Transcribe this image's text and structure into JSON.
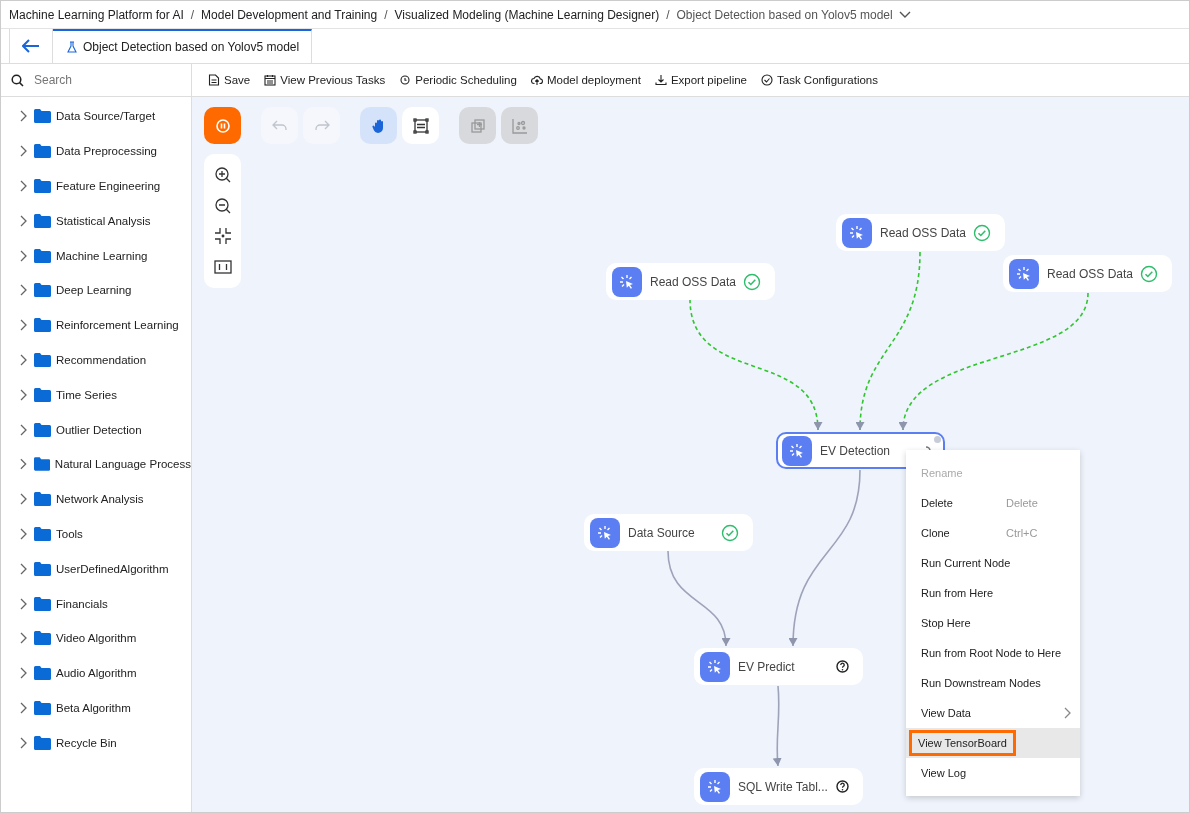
{
  "breadcrumbs": [
    {
      "label": "Machine Learning Platform for AI",
      "current": false,
      "separator": "/"
    },
    {
      "label": "Model Development and Training",
      "current": false,
      "separator": "/"
    },
    {
      "label": "Visualized Modeling (Machine Learning Designer)",
      "current": false,
      "separator": "/"
    },
    {
      "label": "Object Detection based on Yolov5 model",
      "current": true
    }
  ],
  "tabs": [
    {
      "label": "Object Detection based on Yolov5 model",
      "selected": true
    }
  ],
  "search": {
    "placeholder": "Search"
  },
  "toolbar": [
    {
      "kind": "save",
      "label": "Save"
    },
    {
      "kind": "calendar",
      "label": "View Previous Tasks"
    },
    {
      "kind": "clock",
      "label": "Periodic Scheduling"
    },
    {
      "kind": "cloud",
      "label": "Model deployment"
    },
    {
      "kind": "export",
      "label": "Export pipeline"
    },
    {
      "kind": "check",
      "label": "Task Configurations"
    }
  ],
  "sidebar": {
    "items": [
      {
        "label": "Data Source/Target",
        "expanded": false
      },
      {
        "label": "Data Preprocessing",
        "expanded": false
      },
      {
        "label": "Feature Engineering",
        "expanded": false
      },
      {
        "label": "Statistical Analysis",
        "expanded": false
      },
      {
        "label": "Machine Learning",
        "expanded": false
      },
      {
        "label": "Deep Learning",
        "expanded": false
      },
      {
        "label": "Reinforcement Learning",
        "expanded": false
      },
      {
        "label": "Recommendation",
        "expanded": false
      },
      {
        "label": "Time Series",
        "expanded": false
      },
      {
        "label": "Outlier Detection",
        "expanded": false
      },
      {
        "label": "Natural Language Process",
        "expanded": false
      },
      {
        "label": "Network Analysis",
        "expanded": false
      },
      {
        "label": "Tools",
        "expanded": false
      },
      {
        "label": "UserDefinedAlgorithm",
        "expanded": false
      },
      {
        "label": "Financials",
        "expanded": false
      },
      {
        "label": "Video Algorithm",
        "expanded": false
      },
      {
        "label": "Audio Algorithm",
        "expanded": false
      },
      {
        "label": "Beta Algorithm",
        "expanded": false
      },
      {
        "label": "Recycle Bin",
        "expanded": false
      }
    ]
  },
  "canvas_tools": [
    {
      "kind": "pause",
      "disabled": false,
      "selected": false
    },
    {
      "kind": "undo",
      "disabled": true,
      "selected": false
    },
    {
      "kind": "redo",
      "disabled": true,
      "selected": false
    },
    {
      "kind": "hand",
      "disabled": false,
      "selected": true
    },
    {
      "kind": "frame",
      "disabled": false,
      "selected": false
    },
    {
      "kind": "group",
      "disabled": true,
      "selected": false
    },
    {
      "kind": "scatter",
      "disabled": true,
      "selected": false
    }
  ],
  "nodes": [
    {
      "label": "Read OSS Data",
      "kind": "success",
      "selected": false
    },
    {
      "label": "Read OSS Data",
      "kind": "success",
      "selected": false
    },
    {
      "label": "Read OSS Data",
      "kind": "success",
      "selected": false
    },
    {
      "label": "EV Detection",
      "kind": "running",
      "selected": true,
      "inputs": [
        {
          "dashed": true
        },
        {
          "dashed": true
        },
        {
          "dashed": true
        }
      ]
    },
    {
      "label": "Data Source",
      "kind": "success",
      "selected": false
    },
    {
      "label": "EV Predict",
      "kind": "unknown",
      "selected": false,
      "inputs": [
        {
          "dashed": false
        },
        {
          "dashed": false
        }
      ]
    },
    {
      "label": "SQL Write Tabl...",
      "kind": "unknown",
      "selected": false,
      "inputs": [
        {
          "dashed": false
        }
      ]
    }
  ],
  "context_menu": [
    {
      "label": "Rename",
      "disabled": true,
      "submenu": false,
      "selected": false
    },
    {
      "label": "Delete",
      "shortcut": "Delete",
      "disabled": false,
      "submenu": false,
      "selected": false
    },
    {
      "label": "Clone",
      "shortcut": "Ctrl+C",
      "disabled": false,
      "submenu": false,
      "selected": false
    },
    {
      "label": "Run Current Node",
      "disabled": false,
      "submenu": false,
      "selected": false
    },
    {
      "label": "Run from Here",
      "disabled": false,
      "submenu": false,
      "selected": false
    },
    {
      "label": "Stop Here",
      "disabled": false,
      "submenu": false,
      "selected": false
    },
    {
      "label": "Run from Root Node to Here",
      "disabled": false,
      "submenu": false,
      "selected": false
    },
    {
      "label": "Run Downstream Nodes",
      "disabled": false,
      "submenu": false,
      "selected": false
    },
    {
      "label": "View Data",
      "disabled": false,
      "submenu": true,
      "selected": false
    },
    {
      "label": "View TensorBoard",
      "disabled": false,
      "submenu": false,
      "selected": true
    },
    {
      "label": "View Log",
      "disabled": false,
      "submenu": false,
      "selected": false
    }
  ]
}
